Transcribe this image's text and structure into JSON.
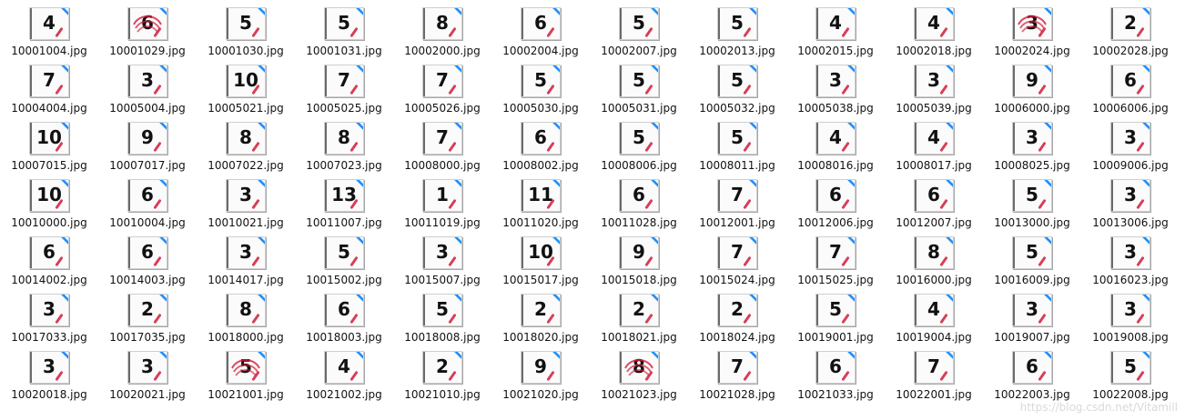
{
  "window": {
    "watermark": "https://blog.csdn.net/Vitamill"
  },
  "icons": {
    "thumbnail_badge_icon": "blue-arrow-pin-icon",
    "thumbnail_mark_icon": "red-checkmark-icon"
  },
  "colors": {
    "background": "#ffffff",
    "text": "#111111",
    "mark_red": "#d11c3a",
    "pin_blue": "#1e90ff"
  },
  "files": [
    {
      "digit": "4",
      "name": "10001004.jpg"
    },
    {
      "digit": "6",
      "name": "10001029.jpg",
      "scribble": true
    },
    {
      "digit": "5",
      "name": "10001030.jpg"
    },
    {
      "digit": "5",
      "name": "10001031.jpg"
    },
    {
      "digit": "8",
      "name": "10002000.jpg"
    },
    {
      "digit": "6",
      "name": "10002004.jpg"
    },
    {
      "digit": "5",
      "name": "10002007.jpg"
    },
    {
      "digit": "5",
      "name": "10002013.jpg"
    },
    {
      "digit": "4",
      "name": "10002015.jpg"
    },
    {
      "digit": "4",
      "name": "10002018.jpg"
    },
    {
      "digit": "3",
      "name": "10002024.jpg",
      "scribble": true
    },
    {
      "digit": "2",
      "name": "10002028.jpg"
    },
    {
      "digit": "7",
      "name": "10004004.jpg"
    },
    {
      "digit": "3",
      "name": "10005004.jpg"
    },
    {
      "digit": "10",
      "name": "10005021.jpg"
    },
    {
      "digit": "7",
      "name": "10005025.jpg"
    },
    {
      "digit": "7",
      "name": "10005026.jpg"
    },
    {
      "digit": "5",
      "name": "10005030.jpg"
    },
    {
      "digit": "5",
      "name": "10005031.jpg"
    },
    {
      "digit": "5",
      "name": "10005032.jpg"
    },
    {
      "digit": "3",
      "name": "10005038.jpg"
    },
    {
      "digit": "3",
      "name": "10005039.jpg"
    },
    {
      "digit": "9",
      "name": "10006000.jpg"
    },
    {
      "digit": "6",
      "name": "10006006.jpg"
    },
    {
      "digit": "10",
      "name": "10007015.jpg"
    },
    {
      "digit": "9",
      "name": "10007017.jpg"
    },
    {
      "digit": "8",
      "name": "10007022.jpg"
    },
    {
      "digit": "8",
      "name": "10007023.jpg"
    },
    {
      "digit": "7",
      "name": "10008000.jpg"
    },
    {
      "digit": "6",
      "name": "10008002.jpg"
    },
    {
      "digit": "5",
      "name": "10008006.jpg"
    },
    {
      "digit": "5",
      "name": "10008011.jpg"
    },
    {
      "digit": "4",
      "name": "10008016.jpg"
    },
    {
      "digit": "4",
      "name": "10008017.jpg"
    },
    {
      "digit": "3",
      "name": "10008025.jpg"
    },
    {
      "digit": "3",
      "name": "10009006.jpg"
    },
    {
      "digit": "10",
      "name": "10010000.jpg"
    },
    {
      "digit": "6",
      "name": "10010004.jpg"
    },
    {
      "digit": "3",
      "name": "10010021.jpg"
    },
    {
      "digit": "13",
      "name": "10011007.jpg"
    },
    {
      "digit": "1",
      "name": "10011019.jpg"
    },
    {
      "digit": "11",
      "name": "10011020.jpg"
    },
    {
      "digit": "6",
      "name": "10011028.jpg"
    },
    {
      "digit": "7",
      "name": "10012001.jpg"
    },
    {
      "digit": "6",
      "name": "10012006.jpg"
    },
    {
      "digit": "6",
      "name": "10012007.jpg"
    },
    {
      "digit": "5",
      "name": "10013000.jpg"
    },
    {
      "digit": "3",
      "name": "10013006.jpg"
    },
    {
      "digit": "6",
      "name": "10014002.jpg"
    },
    {
      "digit": "6",
      "name": "10014003.jpg"
    },
    {
      "digit": "3",
      "name": "10014017.jpg"
    },
    {
      "digit": "5",
      "name": "10015002.jpg"
    },
    {
      "digit": "3",
      "name": "10015007.jpg"
    },
    {
      "digit": "10",
      "name": "10015017.jpg"
    },
    {
      "digit": "9",
      "name": "10015018.jpg"
    },
    {
      "digit": "7",
      "name": "10015024.jpg"
    },
    {
      "digit": "7",
      "name": "10015025.jpg"
    },
    {
      "digit": "8",
      "name": "10016000.jpg"
    },
    {
      "digit": "5",
      "name": "10016009.jpg"
    },
    {
      "digit": "3",
      "name": "10016023.jpg"
    },
    {
      "digit": "3",
      "name": "10017033.jpg"
    },
    {
      "digit": "2",
      "name": "10017035.jpg"
    },
    {
      "digit": "8",
      "name": "10018000.jpg"
    },
    {
      "digit": "6",
      "name": "10018003.jpg"
    },
    {
      "digit": "5",
      "name": "10018008.jpg"
    },
    {
      "digit": "2",
      "name": "10018020.jpg"
    },
    {
      "digit": "2",
      "name": "10018021.jpg"
    },
    {
      "digit": "2",
      "name": "10018024.jpg"
    },
    {
      "digit": "5",
      "name": "10019001.jpg"
    },
    {
      "digit": "4",
      "name": "10019004.jpg"
    },
    {
      "digit": "3",
      "name": "10019007.jpg"
    },
    {
      "digit": "3",
      "name": "10019008.jpg"
    },
    {
      "digit": "3",
      "name": "10020018.jpg"
    },
    {
      "digit": "3",
      "name": "10020021.jpg"
    },
    {
      "digit": "5",
      "name": "10021001.jpg",
      "scribble": true
    },
    {
      "digit": "4",
      "name": "10021002.jpg"
    },
    {
      "digit": "2",
      "name": "10021010.jpg"
    },
    {
      "digit": "9",
      "name": "10021020.jpg"
    },
    {
      "digit": "8",
      "name": "10021023.jpg",
      "scribble": true
    },
    {
      "digit": "7",
      "name": "10021028.jpg"
    },
    {
      "digit": "6",
      "name": "10021033.jpg"
    },
    {
      "digit": "7",
      "name": "10022001.jpg"
    },
    {
      "digit": "6",
      "name": "10022003.jpg"
    },
    {
      "digit": "5",
      "name": "10022008.jpg"
    }
  ]
}
